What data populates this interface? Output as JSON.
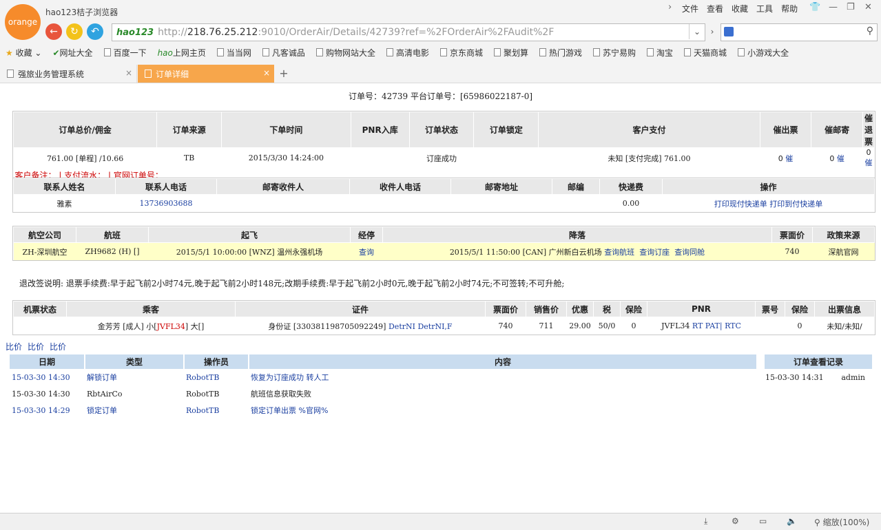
{
  "browser": {
    "logo_text": "orange",
    "title": "hao123桔子浏览器",
    "menu": [
      "文件",
      "查看",
      "收藏",
      "工具",
      "帮助"
    ],
    "addr_logo": "hao123",
    "url_prefix": "http://",
    "url_host": "218.76.25.212",
    "url_rest": ":9010/OrderAir/Details/42739?ref=%2FOrderAir%2FAudit%2F",
    "bookmarks": [
      "收藏",
      "网址大全",
      "百度一下",
      "上网主页",
      "当当网",
      "凡客诚品",
      "购物网站大全",
      "高清电影",
      "京东商城",
      "聚划算",
      "热门游戏",
      "苏宁易购",
      "淘宝",
      "天猫商城",
      "小游戏大全"
    ],
    "tabs": [
      "强旅业务管理系统",
      "订单详细"
    ],
    "zoom": "缩放(100%)"
  },
  "order": {
    "line": "订单号：42739   平台订单号：[65986022187-0]",
    "headers": [
      "订单总价/佣金",
      "订单来源",
      "下单时间",
      "PNR入库",
      "订单状态",
      "订单锁定",
      "客户支付",
      "催出票",
      "催邮寄",
      "催退票"
    ],
    "row": [
      "761.00 [单程] /10.66",
      "TB",
      "2015/3/30 14:24:00",
      "",
      "订座成功",
      "",
      "未知 [支付完成] 761.00",
      "0",
      "0",
      "0"
    ],
    "urge": "催",
    "remark": "客户备注：  | 支付流水：  | 官网订单号："
  },
  "contact": {
    "headers": [
      "联系人姓名",
      "联系人电话",
      "邮寄收件人",
      "收件人电话",
      "邮寄地址",
      "邮编",
      "快递费",
      "操作"
    ],
    "row": [
      "雅素",
      "13736903688",
      "",
      "",
      "",
      "",
      "0.00"
    ],
    "action1": "打印现付快递单",
    "action2": "打印到付快递单"
  },
  "flight": {
    "headers": [
      "航空公司",
      "航班",
      "起飞",
      "经停",
      "降落",
      "票面价",
      "政策来源"
    ],
    "airline": "ZH-深圳航空",
    "flight_no": "ZH9682 (H) []",
    "depart": "2015/5/1 10:00:00 [WNZ] 温州永强机场",
    "stop": "查询",
    "arrive": "2015/5/1 11:50:00 [CAN] 广州新白云机场",
    "q1": "查询航班",
    "q2": "查询订座",
    "q3": "查询同舱",
    "price": "740",
    "policy": "深航官网"
  },
  "refund_note": "退改签说明: 退票手续费:早于起飞前2小时74元,晚于起飞前2小时148元;改期手续费:早于起飞前2小时0元,晚于起飞前2小时74元;不可签转;不可升舱;",
  "passenger": {
    "headers": [
      "机票状态",
      "乘客",
      "证件",
      "票面价",
      "销售价",
      "优惠",
      "税",
      "保险",
      "PNR",
      "票号",
      "保险",
      "出票信息"
    ],
    "status": "",
    "name_a": "金芳芳 [成人] 小[",
    "pnr_red": "JVFL34",
    "name_b": "] 大[]",
    "cert": "身份证 [330381198705092249]",
    "cert_link": "DetrNI DetrNI,F",
    "face": "740",
    "sale": "711",
    "discount": "29.00",
    "tax": "50/0",
    "ins": "0",
    "pnr": "JVFL34",
    "pnr_links": "RT PAT| RTC",
    "ticket_no": "",
    "ins2": "0",
    "issue": "未知/未知/"
  },
  "compare": [
    "比价",
    "比价",
    "比价"
  ],
  "log": {
    "headers": [
      "日期",
      "类型",
      "操作员",
      "内容"
    ],
    "rows": [
      {
        "date": "15-03-30 14:30",
        "type": "解锁订单",
        "op": "RobotTB",
        "content": "恢复为订座成功 转人工"
      },
      {
        "date": "15-03-30 14:30",
        "type": "RbtAirCo",
        "op": "RobotTB",
        "content": "航班信息获取失败"
      },
      {
        "date": "15-03-30 14:29",
        "type": "锁定订单",
        "op": "RobotTB",
        "content": "锁定订单出票 %官网%"
      }
    ]
  },
  "viewlog": {
    "header": "订单查看记录",
    "date": "15-03-30 14:31",
    "user": "admin"
  }
}
